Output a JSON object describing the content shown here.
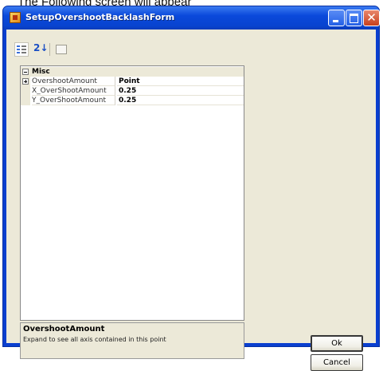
{
  "caption": "The Following screen will appear",
  "window": {
    "title": "SetupOvershootBacklashForm",
    "icons": [
      "app-icon",
      "minimize-icon",
      "maximize-icon",
      "close-icon"
    ]
  },
  "toolbar": {
    "icons": [
      "categorized-icon",
      "alphabetical-icon",
      "property-pages-icon"
    ],
    "alpha_glyph": "2↓"
  },
  "grid": {
    "category": "Misc",
    "properties": [
      {
        "name": "OvershootAmount",
        "value": "Point",
        "expandable": true
      },
      {
        "name": "X_OverShootAmount",
        "value": "0.25"
      },
      {
        "name": "Y_OverShootAmount",
        "value": "0.25"
      }
    ]
  },
  "help": {
    "title": "OvershootAmount",
    "description": "Expand to see all axis contained in this point"
  },
  "buttons": {
    "ok": "Ok",
    "cancel": "Cancel"
  }
}
